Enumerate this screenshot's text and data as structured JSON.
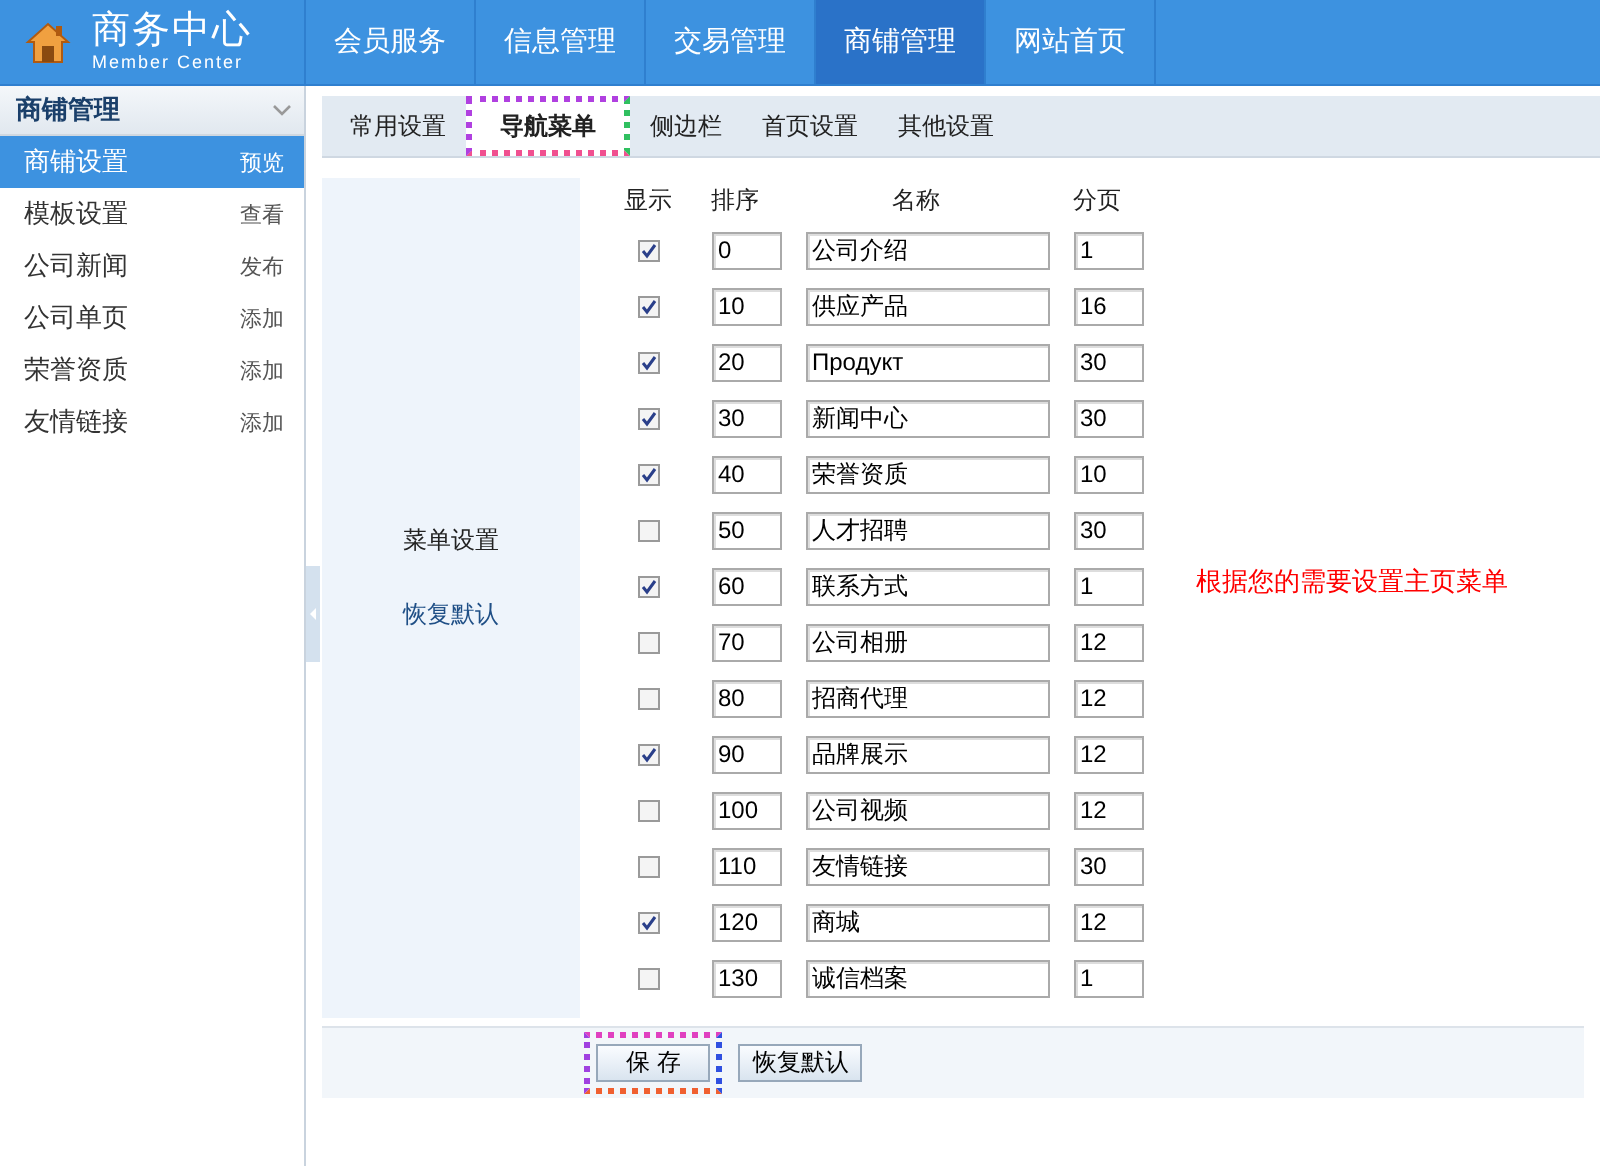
{
  "header": {
    "title": "商务中心",
    "subtitle": "Member Center",
    "nav": [
      {
        "label": "会员服务",
        "selected": false
      },
      {
        "label": "信息管理",
        "selected": false
      },
      {
        "label": "交易管理",
        "selected": false
      },
      {
        "label": "商铺管理",
        "selected": true
      },
      {
        "label": "网站首页",
        "selected": false
      }
    ]
  },
  "sidebar": {
    "title": "商铺管理",
    "expanded": true,
    "items": [
      {
        "label": "商铺设置",
        "action": "预览",
        "selected": true
      },
      {
        "label": "模板设置",
        "action": "查看",
        "selected": false
      },
      {
        "label": "公司新闻",
        "action": "发布",
        "selected": false
      },
      {
        "label": "公司单页",
        "action": "添加",
        "selected": false
      },
      {
        "label": "荣誉资质",
        "action": "添加",
        "selected": false
      },
      {
        "label": "友情链接",
        "action": "添加",
        "selected": false
      }
    ]
  },
  "tabs": [
    {
      "label": "常用设置",
      "selected": false
    },
    {
      "label": "导航菜单",
      "selected": true
    },
    {
      "label": "侧边栏",
      "selected": false
    },
    {
      "label": "首页设置",
      "selected": false
    },
    {
      "label": "其他设置",
      "selected": false
    }
  ],
  "form": {
    "label": "菜单设置",
    "reset_link": "恢复默认",
    "columns": [
      "显示",
      "排序",
      "名称",
      "分页"
    ],
    "rows": [
      {
        "show": true,
        "order": "0",
        "name": "公司介绍",
        "pages": "1"
      },
      {
        "show": true,
        "order": "10",
        "name": "供应产品",
        "pages": "16"
      },
      {
        "show": true,
        "order": "20",
        "name": "Продукт",
        "pages": "30"
      },
      {
        "show": true,
        "order": "30",
        "name": "新闻中心",
        "pages": "30"
      },
      {
        "show": true,
        "order": "40",
        "name": "荣誉资质",
        "pages": "10"
      },
      {
        "show": false,
        "order": "50",
        "name": "人才招聘",
        "pages": "30"
      },
      {
        "show": true,
        "order": "60",
        "name": "联系方式",
        "pages": "1"
      },
      {
        "show": false,
        "order": "70",
        "name": "公司相册",
        "pages": "12"
      },
      {
        "show": false,
        "order": "80",
        "name": "招商代理",
        "pages": "12"
      },
      {
        "show": true,
        "order": "90",
        "name": "品牌展示",
        "pages": "12"
      },
      {
        "show": false,
        "order": "100",
        "name": "公司视频",
        "pages": "12"
      },
      {
        "show": false,
        "order": "110",
        "name": "友情链接",
        "pages": "30"
      },
      {
        "show": true,
        "order": "120",
        "name": "商城",
        "pages": "12"
      },
      {
        "show": false,
        "order": "130",
        "name": "诚信档案",
        "pages": "1"
      }
    ],
    "hint": "根据您的需要设置主页菜单",
    "buttons": [
      {
        "label": "保 存",
        "highlighted": true
      },
      {
        "label": "恢复默认",
        "highlighted": false
      }
    ]
  }
}
